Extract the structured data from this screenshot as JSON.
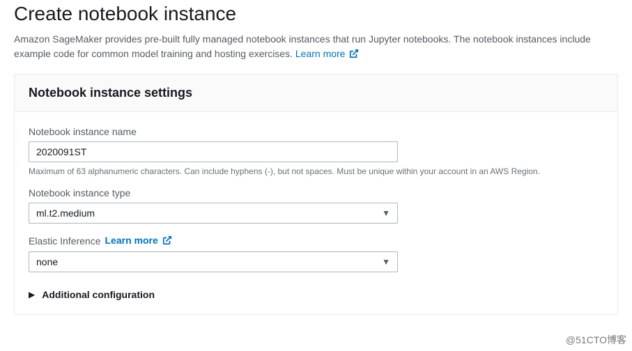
{
  "page": {
    "title": "Create notebook instance",
    "description_part1": "Amazon SageMaker provides pre-built fully managed notebook instances that run Jupyter notebooks. The notebook instances include example code for common model training and hosting exercises. ",
    "learn_more": "Learn more"
  },
  "card": {
    "header": "Notebook instance settings"
  },
  "fields": {
    "name_label": "Notebook instance name",
    "name_value": "2020091ST",
    "name_hint": "Maximum of 63 alphanumeric characters. Can include hyphens (-), but not spaces. Must be unique within your account in an AWS Region.",
    "type_label": "Notebook instance type",
    "type_value": "ml.t2.medium",
    "elastic_label": "Elastic Inference",
    "elastic_learn_more": "Learn more",
    "elastic_value": "none",
    "additional_config": "Additional configuration"
  },
  "watermark": "@51CTO博客"
}
